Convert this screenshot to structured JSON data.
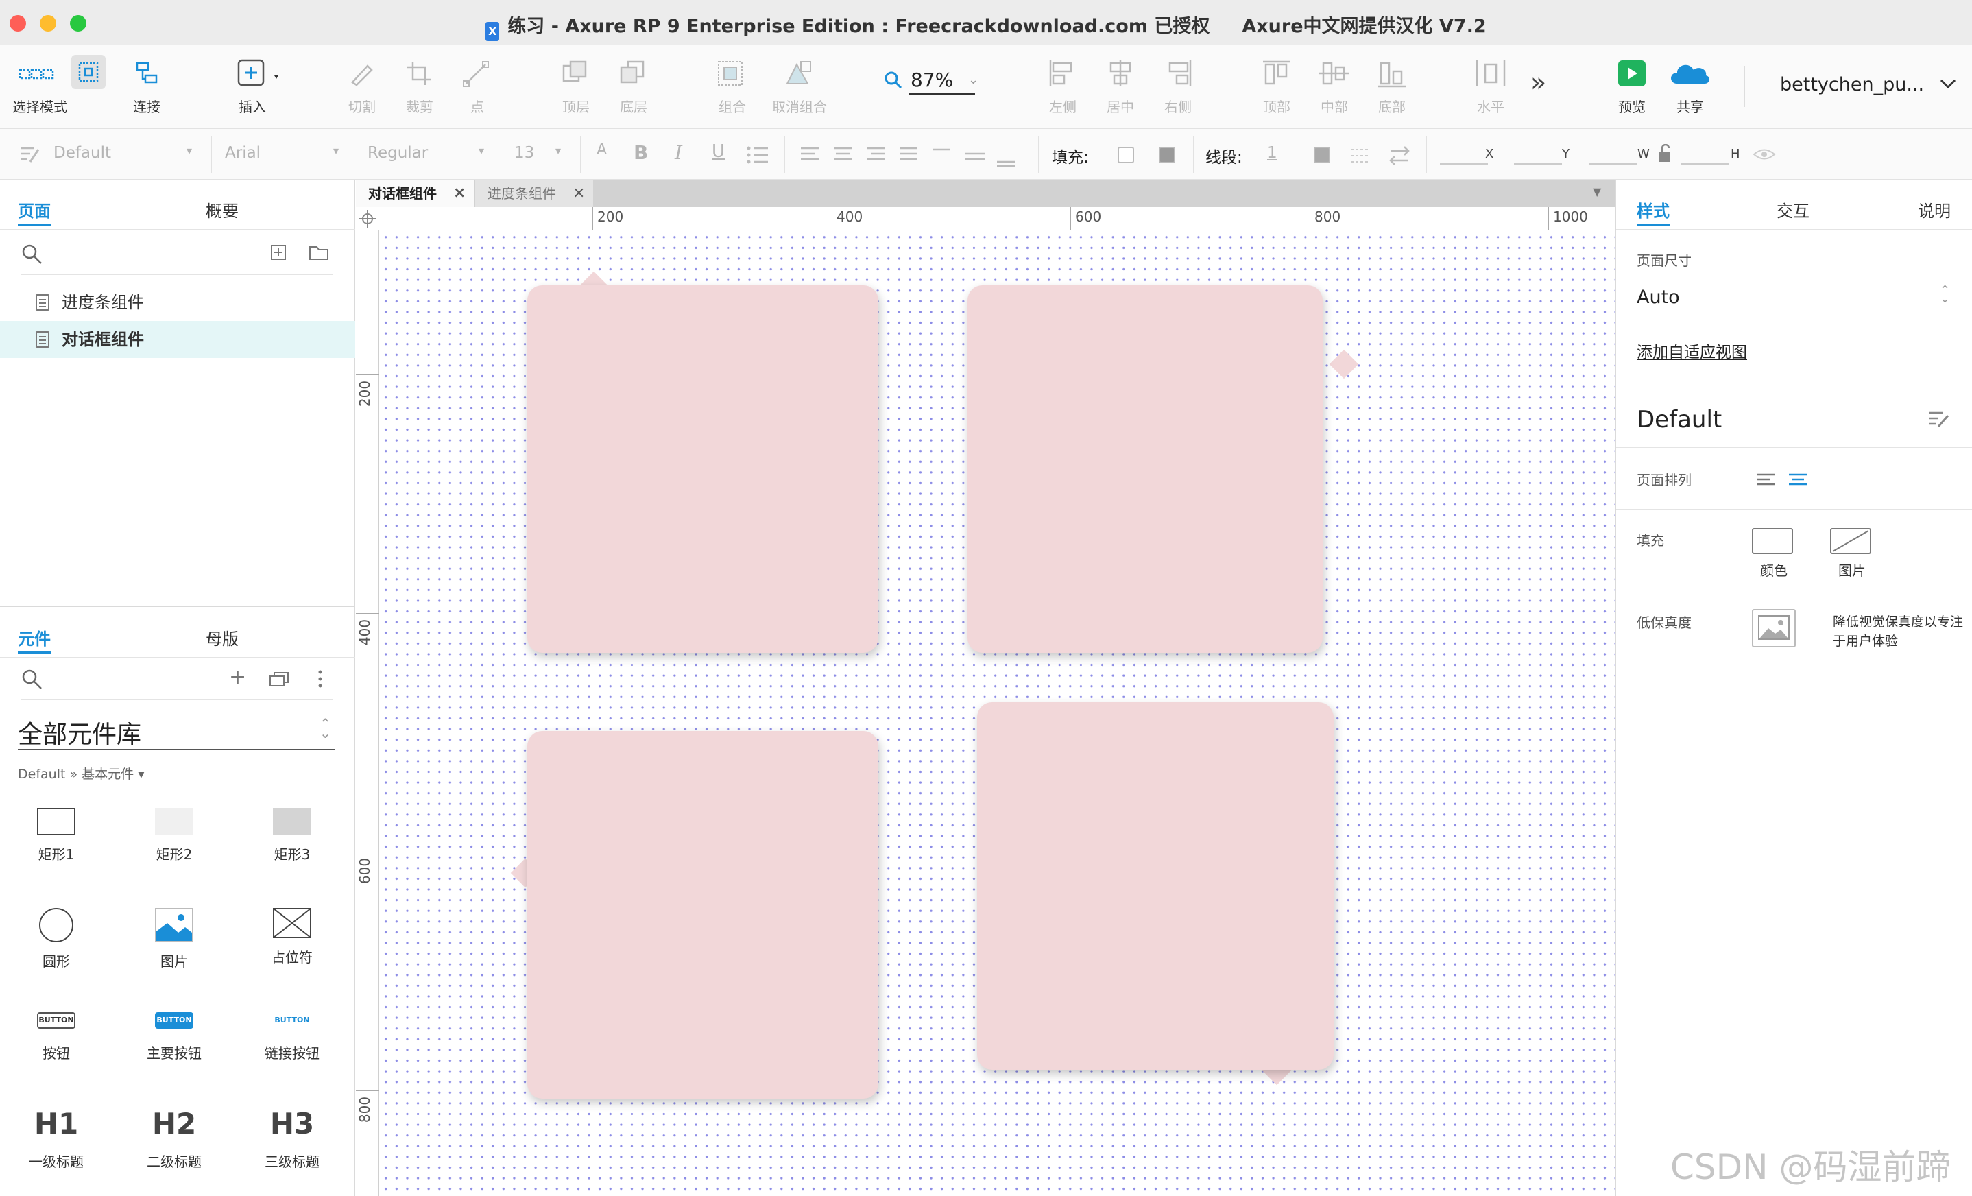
{
  "window": {
    "title": "练习 - Axure RP 9 Enterprise Edition : Freecrackdownload.com 已授权     Axure中文网提供汉化 V7.2",
    "app_icon": "X"
  },
  "toolbar": {
    "select_mode": "选择模式",
    "connect": "连接",
    "insert": "插入",
    "cut": "切割",
    "crop": "裁剪",
    "point": "点",
    "top_layer": "顶层",
    "bottom_layer": "底层",
    "group": "组合",
    "ungroup": "取消组合",
    "zoom": "87%",
    "align_left": "左侧",
    "align_center": "居中",
    "align_right": "右侧",
    "align_top": "顶部",
    "align_middle": "中部",
    "align_bottom": "底部",
    "distribute_h": "水平",
    "more": "»",
    "preview": "预览",
    "share": "共享",
    "user": "bettychen_pu..."
  },
  "formatbar": {
    "style": "Default",
    "font": "Arial",
    "weight": "Regular",
    "size": "13",
    "fill_label": "填充:",
    "stroke_label": "线段:",
    "stroke_value": "1",
    "x": "X",
    "y": "Y",
    "w": "W",
    "h": "H"
  },
  "left": {
    "tabs": [
      "页面",
      "概要"
    ],
    "pages": [
      "进度条组件",
      "对话框组件"
    ],
    "selected_page": 1,
    "lib_tabs": [
      "元件",
      "母版"
    ],
    "library_name": "全部元件库",
    "breadcrumb": "Default » 基本元件 ▾",
    "widgets": [
      {
        "label": "矩形1"
      },
      {
        "label": "矩形2"
      },
      {
        "label": "矩形3"
      },
      {
        "label": "圆形"
      },
      {
        "label": "图片"
      },
      {
        "label": "占位符"
      },
      {
        "label": "按钮",
        "text": "BUTTON"
      },
      {
        "label": "主要按钮",
        "text": "BUTTON"
      },
      {
        "label": "链接按钮",
        "text": "BUTTON"
      },
      {
        "label": "一级标题",
        "text": "H1"
      },
      {
        "label": "二级标题",
        "text": "H2"
      },
      {
        "label": "三级标题",
        "text": "H3"
      }
    ]
  },
  "canvas": {
    "doc_tabs": [
      "对话框组件",
      "进度条组件"
    ],
    "ruler_x": [
      "200",
      "400",
      "600",
      "800",
      "1000"
    ],
    "ruler_y": [
      "200",
      "400",
      "600",
      "800"
    ],
    "bubble_color": "#f2d7d9",
    "dot_color": "#8d8de6"
  },
  "right": {
    "tabs": [
      "样式",
      "交互",
      "说明"
    ],
    "page_size_label": "页面尺寸",
    "page_size": "Auto",
    "adaptive_link": "添加自适应视图",
    "style_name": "Default",
    "arrange_label": "页面排列",
    "fill_label": "填充",
    "fill_color": "颜色",
    "fill_image": "图片",
    "low_fidelity_label": "低保真度",
    "low_fidelity_desc_1": "降低视觉保真度以专注",
    "low_fidelity_desc_2": "于用户体验"
  },
  "watermark": "CSDN @码湿前蹄",
  "colors": {
    "accent": "#1a8ed7",
    "selected_row": "#e4f6f7"
  }
}
